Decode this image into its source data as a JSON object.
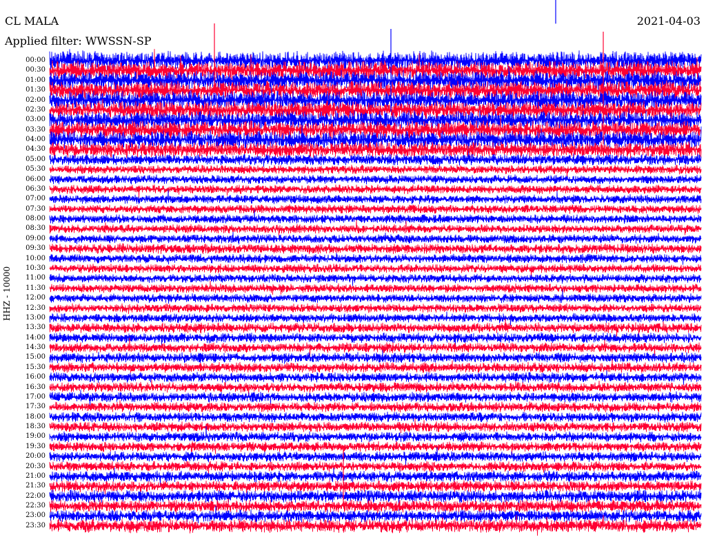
{
  "header": {
    "station": "CL MALA",
    "date": "2021-04-03",
    "filter": "Applied filter: WWSSN-SP"
  },
  "side_label": "HHZ - 10000",
  "chart_data": {
    "type": "line",
    "title": "",
    "xlabel": "",
    "ylabel": "HHZ - 10000",
    "row_minutes": 30,
    "row_labels": [
      "00:00",
      "00:30",
      "01:00",
      "01:30",
      "02:00",
      "02:30",
      "03:00",
      "03:30",
      "04:00",
      "04:30",
      "05:00",
      "05:30",
      "06:00",
      "06:30",
      "07:00",
      "07:30",
      "08:00",
      "08:30",
      "09:00",
      "09:30",
      "10:00",
      "10:30",
      "11:00",
      "11:30",
      "12:00",
      "12:30",
      "13:00",
      "13:30",
      "14:00",
      "14:30",
      "15:00",
      "15:30",
      "16:00",
      "16:30",
      "17:00",
      "17:30",
      "18:00",
      "18:30",
      "19:00",
      "19:30",
      "20:00",
      "20:30",
      "21:00",
      "21:30",
      "22:00",
      "22:30",
      "23:00",
      "23:30"
    ],
    "row_amplitude": [
      1.7,
      1.7,
      1.7,
      1.7,
      1.7,
      1.6,
      1.6,
      1.6,
      1.6,
      1.4,
      1.0,
      0.8,
      0.8,
      0.8,
      0.8,
      0.8,
      0.8,
      0.8,
      0.8,
      0.9,
      0.8,
      0.8,
      0.8,
      0.8,
      0.8,
      0.8,
      0.8,
      0.9,
      0.9,
      0.9,
      0.9,
      0.9,
      0.9,
      0.9,
      0.9,
      0.9,
      0.9,
      0.9,
      0.9,
      0.9,
      0.9,
      0.9,
      1.0,
      1.0,
      1.1,
      1.1,
      1.1,
      1.2
    ],
    "series_colors": [
      "#0000ff",
      "#ff0033"
    ],
    "background": "#ffffff"
  }
}
